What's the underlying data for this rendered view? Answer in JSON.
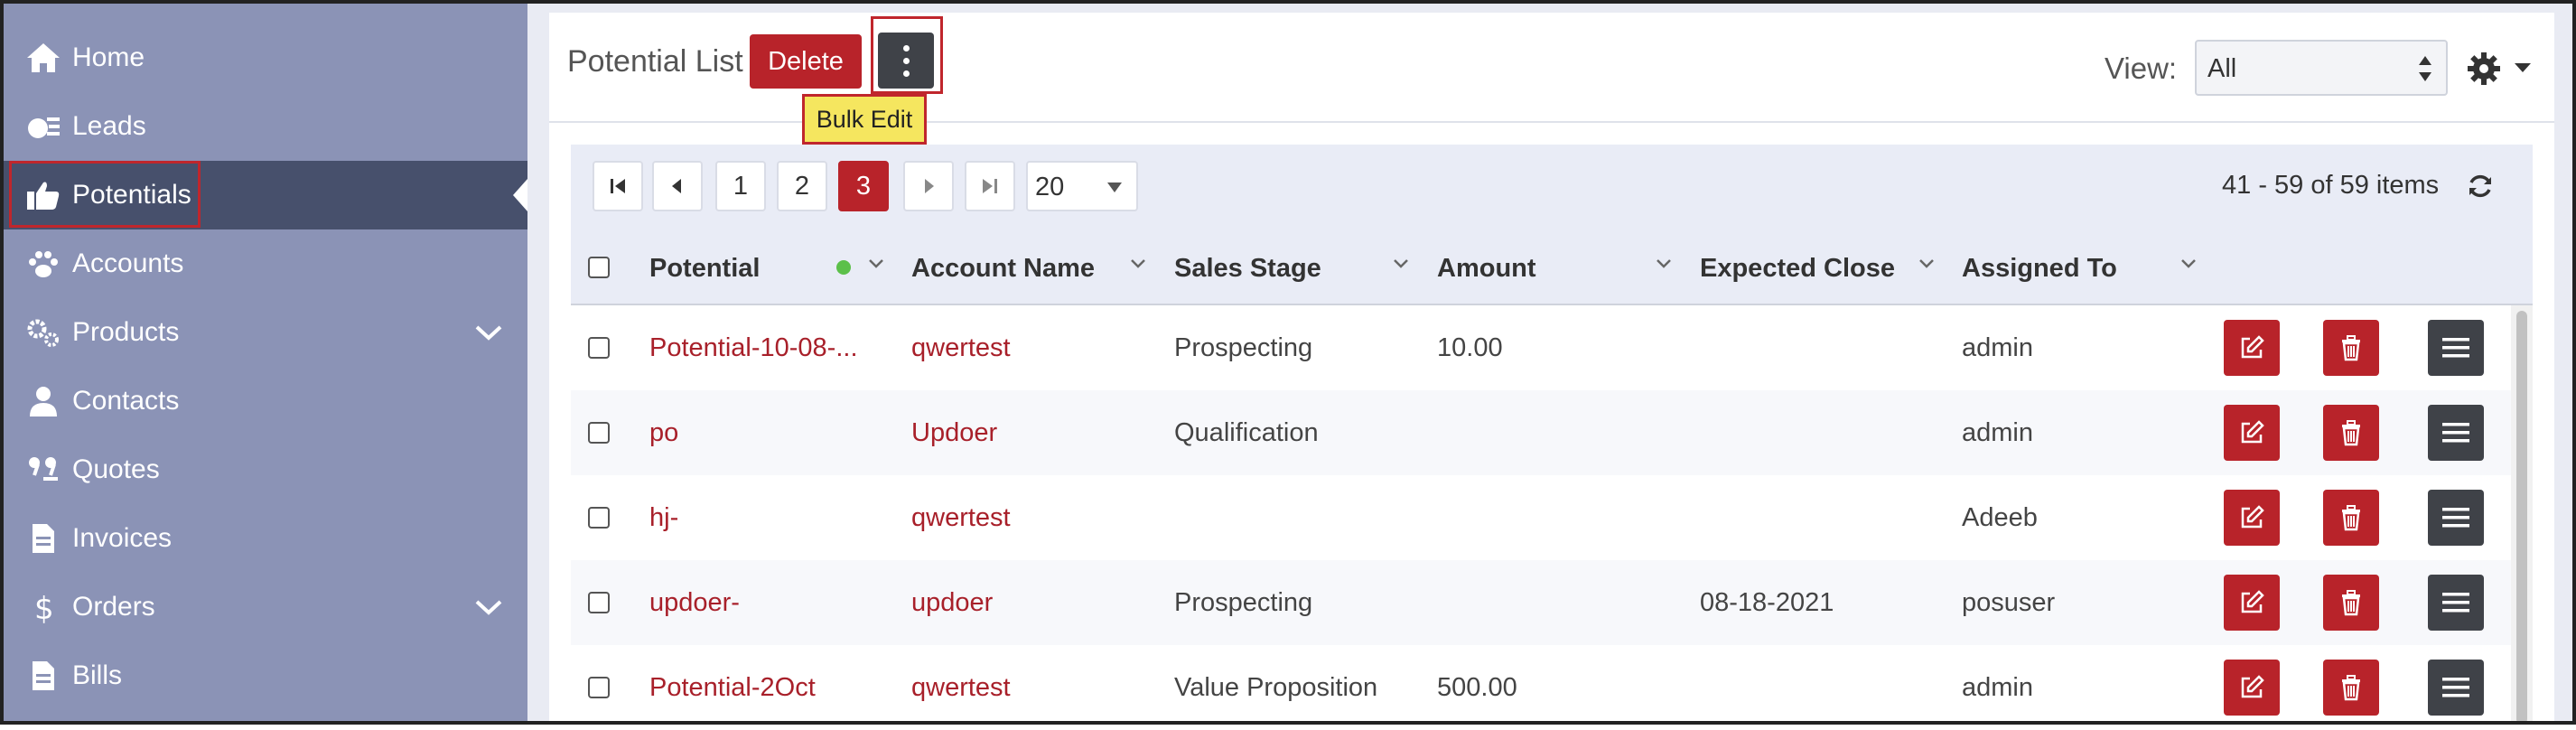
{
  "sidebar": {
    "items": [
      {
        "label": "Home",
        "icon": "home-icon"
      },
      {
        "label": "Leads",
        "icon": "leads-icon"
      },
      {
        "label": "Potentials",
        "icon": "thumbs-up-icon",
        "active": true
      },
      {
        "label": "Accounts",
        "icon": "paw-icon"
      },
      {
        "label": "Products",
        "icon": "gears-icon",
        "expandable": true
      },
      {
        "label": "Contacts",
        "icon": "user-icon"
      },
      {
        "label": "Quotes",
        "icon": "quote-icon"
      },
      {
        "label": "Invoices",
        "icon": "file-icon"
      },
      {
        "label": "Orders",
        "icon": "dollar-icon",
        "expandable": true
      },
      {
        "label": "Bills",
        "icon": "file-icon"
      }
    ]
  },
  "header": {
    "title": "Potential List",
    "delete_label": "Delete",
    "tooltip": "Bulk Edit",
    "view_label": "View:",
    "view_value": "All"
  },
  "pager": {
    "pages": [
      "1",
      "2",
      "3"
    ],
    "current_page": "3",
    "page_size": "20",
    "range_text": "41 - 59 of 59 items"
  },
  "grid": {
    "columns": [
      "Potential",
      "Account Name",
      "Sales Stage",
      "Amount",
      "Expected Close",
      "Assigned To"
    ],
    "rows": [
      {
        "potential": "Potential-10-08-...",
        "account": "qwertest",
        "stage": "Prospecting",
        "amount": "10.00",
        "close": "",
        "assigned": "admin"
      },
      {
        "potential": "po",
        "account": "Updoer",
        "stage": "Qualification",
        "amount": "",
        "close": "",
        "assigned": "admin"
      },
      {
        "potential": "hj-",
        "account": "qwertest",
        "stage": "",
        "amount": "",
        "close": "",
        "assigned": "Adeeb"
      },
      {
        "potential": "updoer-",
        "account": "updoer",
        "stage": "Prospecting",
        "amount": "",
        "close": "08-18-2021",
        "assigned": "posuser"
      },
      {
        "potential": "Potential-2Oct",
        "account": "qwertest",
        "stage": "Value Proposition",
        "amount": "500.00",
        "close": "",
        "assigned": "admin"
      }
    ]
  },
  "colors": {
    "sidebar_bg": "#8b93b6",
    "sidebar_active": "#47506c",
    "accent_red": "#b8232a",
    "link": "#a8202a",
    "tooltip_bg": "#f5e65f",
    "highlight_border": "#c0262c"
  }
}
